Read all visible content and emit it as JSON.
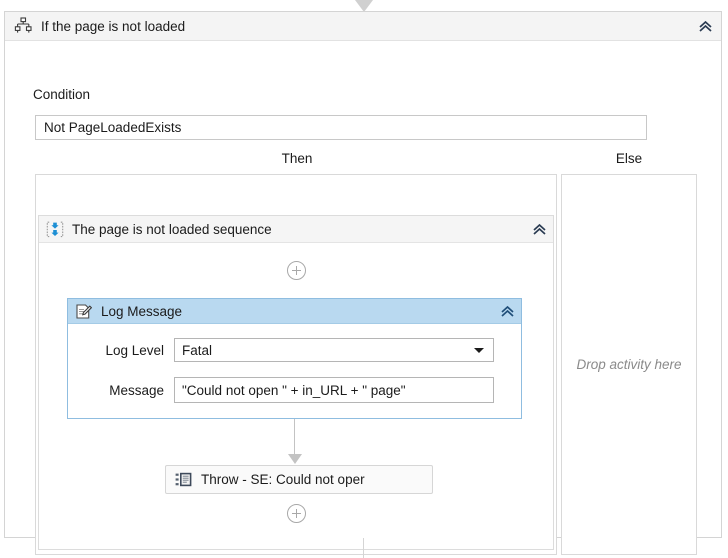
{
  "activity": {
    "title": "If the page is not loaded",
    "icon": "if-branch-icon",
    "collapse_icon": "chevron-double-up-icon"
  },
  "condition": {
    "label": "Condition",
    "value": "Not PageLoadedExists"
  },
  "branches": {
    "then_label": "Then",
    "else_label": "Else",
    "else_placeholder": "Drop activity here"
  },
  "sequence": {
    "title": "The page is not loaded sequence",
    "icon": "sequence-icon",
    "collapse_icon": "chevron-double-up-icon"
  },
  "log_message": {
    "title": "Log Message",
    "icon": "log-message-pencil-icon",
    "collapse_icon": "chevron-double-up-icon",
    "fields": {
      "level_label": "Log Level",
      "level_value": "Fatal",
      "message_label": "Message",
      "message_value": "\"Could not open \" + in_URL + \" page\""
    }
  },
  "throw": {
    "title": "Throw - SE: Could not oper",
    "icon": "throw-activity-icon"
  },
  "add_buttons": {
    "top_label": "+",
    "bottom_label": "+"
  },
  "colors": {
    "selection_header": "#b9d9f0",
    "selection_border": "#8fbde0",
    "panel_header": "#f4f4f4",
    "panel_border": "#d4d4d4",
    "connector": "#c3c3c3",
    "placeholder_text": "#8a8a8a"
  }
}
